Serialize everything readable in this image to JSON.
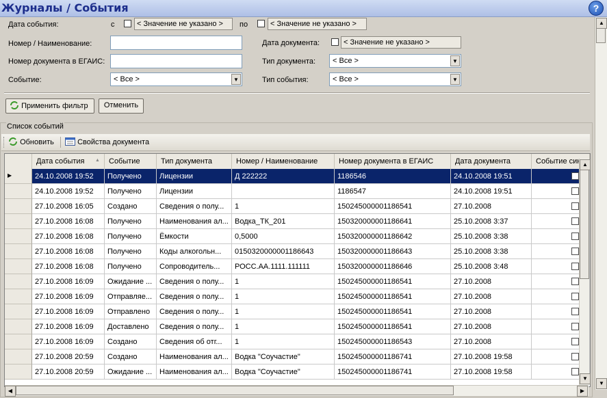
{
  "header": {
    "title": "Журналы / События",
    "help_icon": "?"
  },
  "filter": {
    "event_date_label": "Дата события:",
    "from_label": "с",
    "from_value": "< Значение не указано >",
    "to_label": "по",
    "to_value": "< Значение не указано >",
    "number_label": "Номер / Наименование:",
    "egais_number_label": "Номер документа в ЕГАИС:",
    "event_label": "Событие:",
    "event_value": "< Все >",
    "doc_date_label": "Дата документа:",
    "doc_date_value": "< Значение не указано >",
    "doc_type_label": "Тип документа:",
    "doc_type_value": "< Все >",
    "event_type_label": "Тип события:",
    "event_type_value": "< Все >",
    "apply_label": "Применить фильтр",
    "cancel_label": "Отменить"
  },
  "list": {
    "title": "Список событий",
    "refresh_label": "Обновить",
    "properties_label": "Свойства документа",
    "columns": [
      "Дата события",
      "Событие",
      "Тип документа",
      "Номер / Наименование",
      "Номер документа в ЕГАИС",
      "Дата документа",
      "Событие синхр"
    ],
    "rows": [
      [
        "24.10.2008 19:52",
        "Получено",
        "Лицензии",
        "Д 222222",
        "1186546",
        "24.10.2008 19:51"
      ],
      [
        "24.10.2008 19:52",
        "Получено",
        "Лицензии",
        "",
        "1186547",
        "24.10.2008 19:51"
      ],
      [
        "27.10.2008 16:05",
        "Создано",
        "Сведения о полу...",
        "1",
        "150245000001186541",
        "27.10.2008"
      ],
      [
        "27.10.2008 16:08",
        "Получено",
        "Наименования ал...",
        "Водка_ТК_201",
        "150320000001186641",
        "25.10.2008 3:37"
      ],
      [
        "27.10.2008 16:08",
        "Получено",
        "Ёмкости",
        "0,5000",
        "150320000001186642",
        "25.10.2008 3:38"
      ],
      [
        "27.10.2008 16:08",
        "Получено",
        "Коды алкогольн...",
        "0150320000001186643",
        "150320000001186643",
        "25.10.2008 3:38"
      ],
      [
        "27.10.2008 16:08",
        "Получено",
        "Сопроводитель...",
        "РОСС.АА.1111.111111",
        "150320000001186646",
        "25.10.2008 3:48"
      ],
      [
        "27.10.2008 16:09",
        "Ожидание ...",
        "Сведения о полу...",
        "1",
        "150245000001186541",
        "27.10.2008"
      ],
      [
        "27.10.2008 16:09",
        "Отправляе...",
        "Сведения о полу...",
        "1",
        "150245000001186541",
        "27.10.2008"
      ],
      [
        "27.10.2008 16:09",
        "Отправлено",
        "Сведения о полу...",
        "1",
        "150245000001186541",
        "27.10.2008"
      ],
      [
        "27.10.2008 16:09",
        "Доставлено",
        "Сведения о полу...",
        "1",
        "150245000001186541",
        "27.10.2008"
      ],
      [
        "27.10.2008 16:09",
        "Создано",
        "Сведения об отг...",
        "1",
        "150245000001186543",
        "27.10.2008"
      ],
      [
        "27.10.2008 20:59",
        "Создано",
        "Наименования ал...",
        "Водка \"Соучастие\"",
        "150245000001186741",
        "27.10.2008 19:58"
      ],
      [
        "27.10.2008 20:59",
        "Ожидание ...",
        "Наименования ал...",
        "Водка \"Соучастие\"",
        "150245000001186741",
        "27.10.2008 19:58"
      ]
    ]
  }
}
